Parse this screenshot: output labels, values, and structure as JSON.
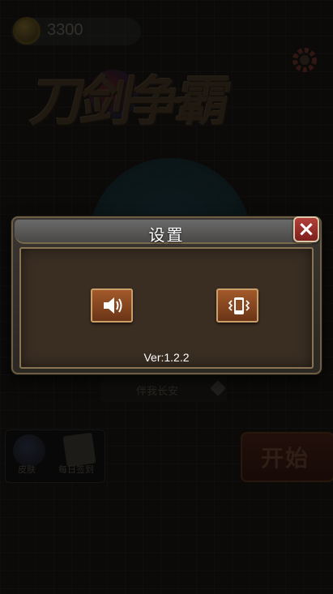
{
  "coins": "3300",
  "logo_text": "刀剑争霸",
  "name_field": "伴我长安",
  "menu": {
    "skin_label": "皮肤",
    "signin_label": "每日签到",
    "start_label": "开始"
  },
  "settings_dialog": {
    "title": "设置",
    "close_icon": "×",
    "sound_icon": "speaker-icon",
    "vibrate_icon": "phone-vibrate-icon",
    "version": "Ver:1.2.2"
  },
  "colors": {
    "dialog_border": "#6e5e44",
    "button_orange": "#a2592a",
    "close_red": "#b3403b"
  }
}
